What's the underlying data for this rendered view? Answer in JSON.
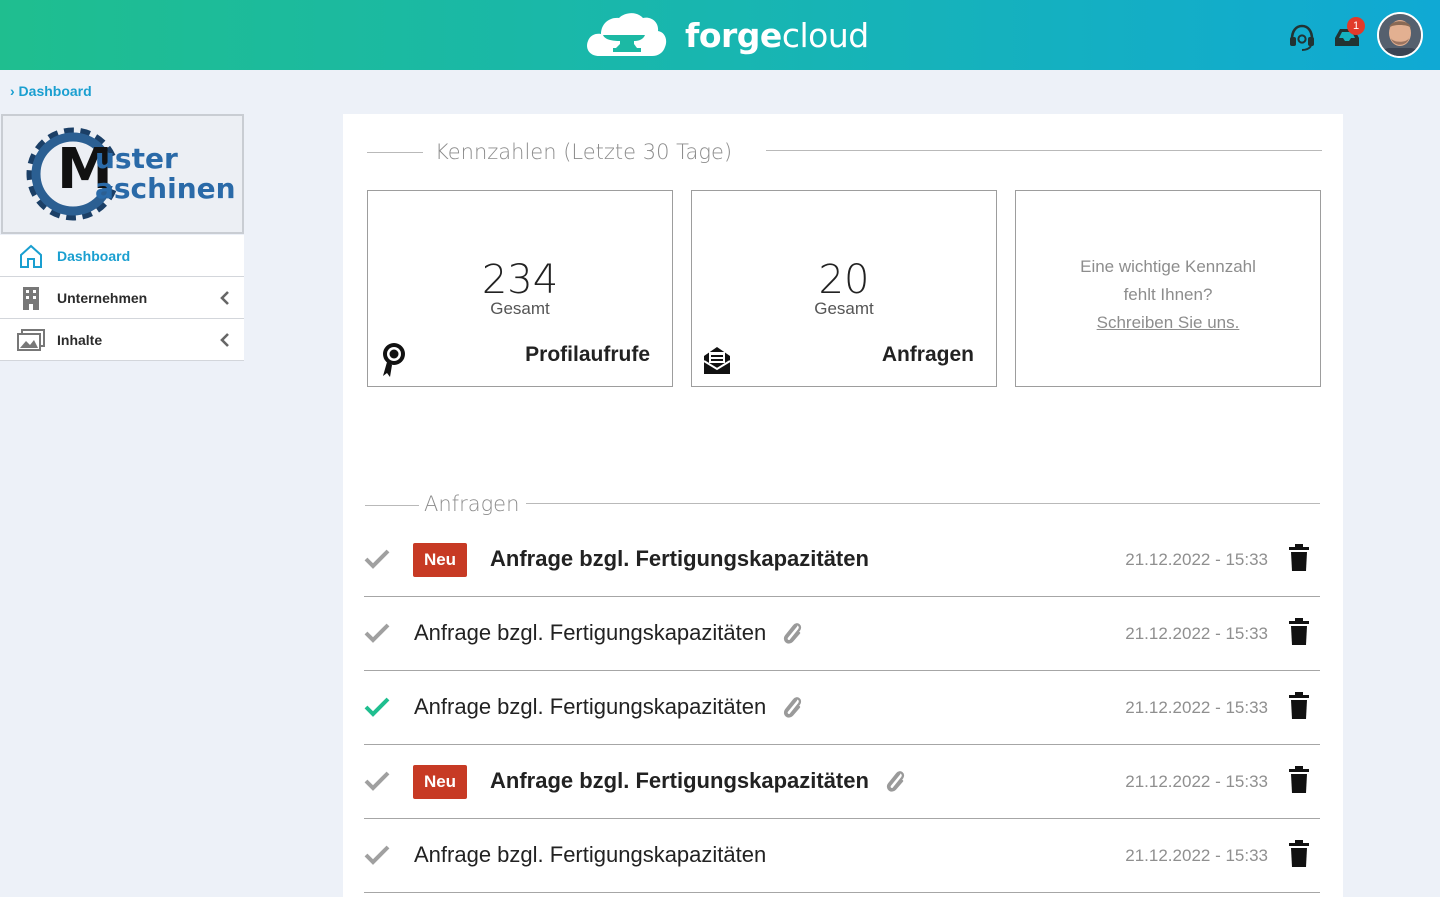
{
  "header": {
    "brand_bold": "forge",
    "brand_light": "cloud",
    "notification_count": "1",
    "icons": [
      "cloud-anvil-logo-icon",
      "headset-icon",
      "inbox-icon",
      "avatar"
    ]
  },
  "breadcrumb": {
    "label": "› Dashboard"
  },
  "sidebar": {
    "company_logo_alt": "Muster Maschinen",
    "items": [
      {
        "label": "Dashboard",
        "icon": "home-icon",
        "active": true
      },
      {
        "label": "Unternehmen",
        "icon": "building-icon",
        "active": false
      },
      {
        "label": "Inhalte",
        "icon": "images-icon",
        "active": false
      }
    ]
  },
  "kpi": {
    "section_title": "Kennzahlen (Letzte 30 Tage)",
    "cards": [
      {
        "value": "234",
        "sub": "Gesamt",
        "caption": "Profilaufrufe",
        "icon": "award-icon"
      },
      {
        "value": "20",
        "sub": "Gesamt",
        "caption": "Anfragen",
        "icon": "envelope-open-icon"
      }
    ],
    "missing": {
      "line1": "Eine wichtige Kennzahl",
      "line2": "fehlt Ihnen?",
      "link": "Schreiben Sie uns."
    }
  },
  "requests": {
    "section_title": "Anfragen",
    "new_label": "Neu",
    "items": [
      {
        "title": "Anfrage bzgl. Fertigungskapazitäten",
        "date": "21.12.2022 - 15:33",
        "new": true,
        "attachment": false,
        "read": false
      },
      {
        "title": "Anfrage bzgl. Fertigungskapazitäten",
        "date": "21.12.2022 - 15:33",
        "new": false,
        "attachment": true,
        "read": false
      },
      {
        "title": "Anfrage bzgl. Fertigungskapazitäten",
        "date": "21.12.2022 - 15:33",
        "new": false,
        "attachment": true,
        "read": true
      },
      {
        "title": "Anfrage bzgl. Fertigungskapazitäten",
        "date": "21.12.2022 - 15:33",
        "new": true,
        "attachment": true,
        "read": false
      },
      {
        "title": "Anfrage bzgl. Fertigungskapazitäten",
        "date": "21.12.2022 - 15:33",
        "new": false,
        "attachment": false,
        "read": false
      }
    ]
  },
  "colors": {
    "accent": "#1a9fd0",
    "new_badge": "#c73a24",
    "check_read": "#1fbe8f",
    "check_unread": "#a0a0a0"
  }
}
